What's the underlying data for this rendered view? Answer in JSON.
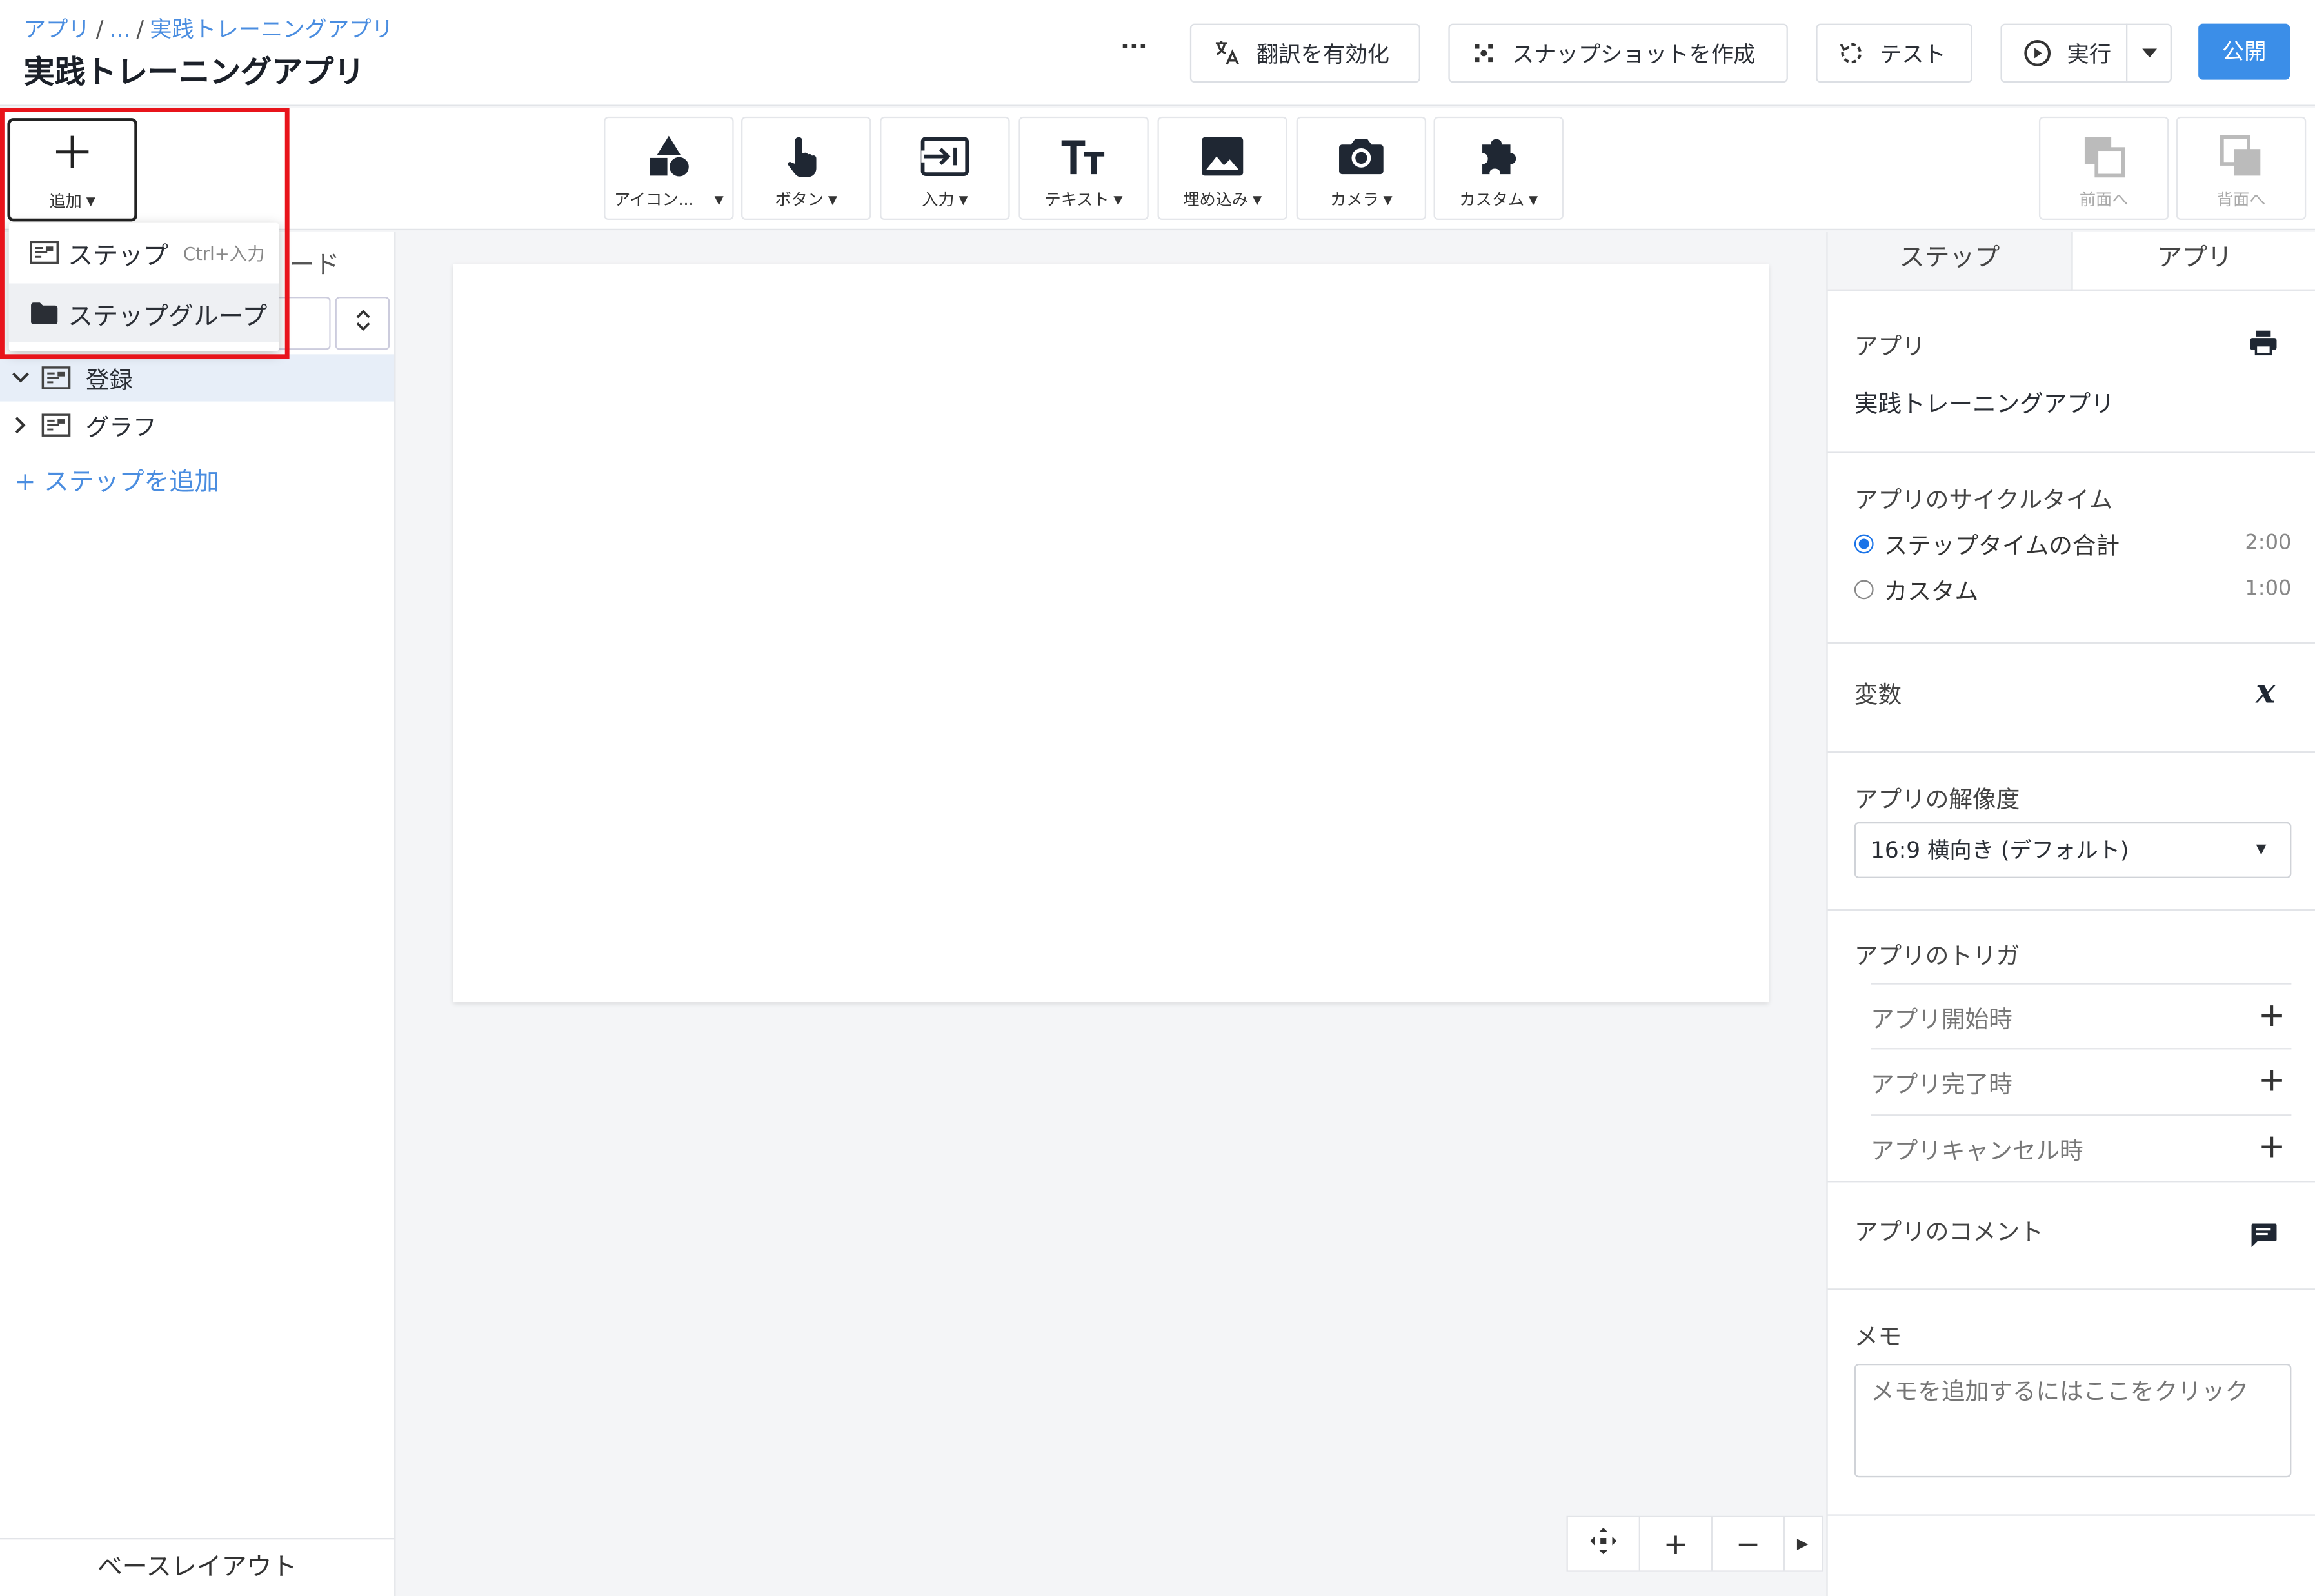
{
  "header": {
    "breadcrumb": [
      "アプリ",
      "...",
      "実践トレーニングアプリ"
    ],
    "title": "実践トレーニングアプリ",
    "more_label": "···",
    "buttons": {
      "translate": "翻訳を有効化",
      "snapshot": "スナップショットを作成",
      "test": "テスト",
      "run": "実行",
      "publish": "公開"
    }
  },
  "toolbar": {
    "add_label": "追加",
    "tools": [
      {
        "label": "アイコン...",
        "icon": "shapes-icon"
      },
      {
        "label": "ボタン",
        "icon": "pointer-hand-icon"
      },
      {
        "label": "入力",
        "icon": "input-icon"
      },
      {
        "label": "テキスト",
        "icon": "text-icon"
      },
      {
        "label": "埋め込み",
        "icon": "image-icon"
      },
      {
        "label": "カメラ",
        "icon": "camera-icon"
      },
      {
        "label": "カスタム",
        "icon": "puzzle-icon"
      }
    ],
    "bring_front": "前面へ",
    "send_back": "背面へ"
  },
  "add_menu": {
    "items": [
      {
        "label": "ステップ",
        "shortcut": "Ctrl+入力"
      },
      {
        "label": "ステップグループ",
        "shortcut": ""
      }
    ]
  },
  "left_panel": {
    "tab_behind": "ード",
    "steps": [
      {
        "label": "登録",
        "expanded": true
      },
      {
        "label": "グラフ",
        "expanded": false
      }
    ],
    "add_step": "ステップを追加",
    "base_layout": "ベースレイアウト"
  },
  "right_panel": {
    "tabs": [
      "ステップ",
      "アプリ"
    ],
    "app_section_label": "アプリ",
    "app_name": "実践トレーニングアプリ",
    "cycle_time": {
      "label": "アプリのサイクルタイム",
      "options": [
        {
          "label": "ステップタイムの合計",
          "time": "2:00",
          "selected": true
        },
        {
          "label": "カスタム",
          "time": "1:00",
          "selected": false
        }
      ]
    },
    "variables_label": "変数",
    "resolution": {
      "label": "アプリの解像度",
      "value": "16:9 横向き (デフォルト)"
    },
    "triggers": {
      "label": "アプリのトリガ",
      "items": [
        "アプリ開始時",
        "アプリ完了時",
        "アプリキャンセル時"
      ]
    },
    "comments_label": "アプリのコメント",
    "memo": {
      "label": "メモ",
      "placeholder": "メモを追加するにはここをクリック"
    }
  },
  "colors": {
    "accent": "#3b8ee8",
    "highlight": "#e8141b",
    "active_row": "#e7eef8"
  }
}
